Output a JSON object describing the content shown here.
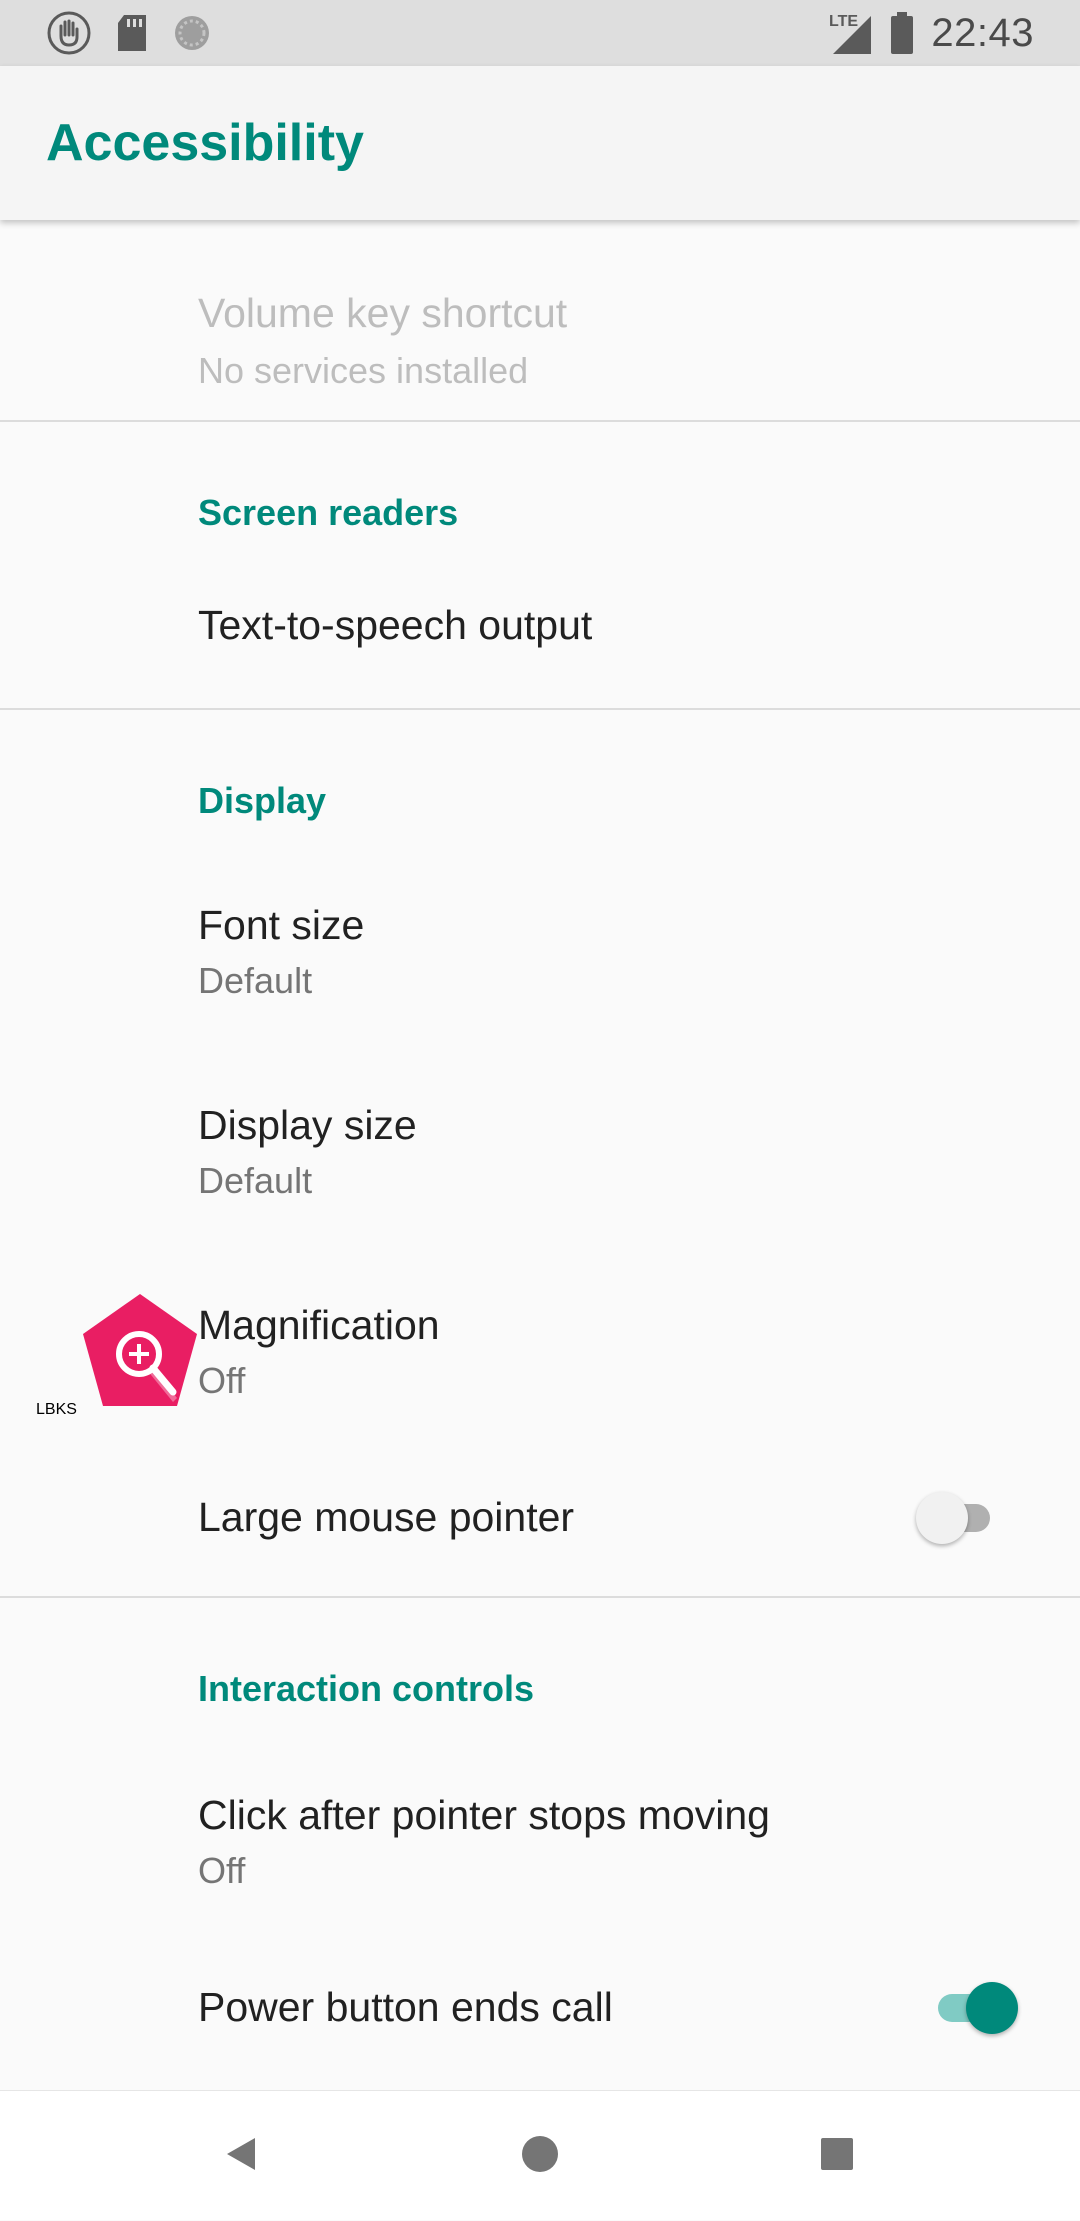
{
  "status_bar": {
    "time": "22:43",
    "network_label": "LTE",
    "icons": [
      "hand-icon",
      "sd-card-icon",
      "sync-icon",
      "signal-icon",
      "battery-icon"
    ]
  },
  "app_bar": {
    "title": "Accessibility"
  },
  "sections": {
    "volume": {
      "title": "Volume key shortcut",
      "summary": "No services installed"
    },
    "screen_readers": {
      "header": "Screen readers",
      "tts": {
        "title": "Text-to-speech output"
      }
    },
    "display": {
      "header": "Display",
      "font_size": {
        "title": "Font size",
        "summary": "Default"
      },
      "display_size": {
        "title": "Display size",
        "summary": "Default"
      },
      "magnification": {
        "title": "Magnification",
        "summary": "Off",
        "icon": "magnification-icon"
      },
      "large_pointer": {
        "title": "Large mouse pointer",
        "checked": false
      }
    },
    "interaction": {
      "header": "Interaction controls",
      "click_after_stop": {
        "title": "Click after pointer stops moving",
        "summary": "Off"
      },
      "power_ends_call": {
        "title": "Power button ends call",
        "checked": true
      }
    }
  },
  "nav_bar": {
    "buttons": [
      "back-icon",
      "home-icon",
      "recents-icon"
    ]
  },
  "colors": {
    "accent": "#00897b",
    "magnification_icon": "#e91e63",
    "status_bar_bg": "#dedede",
    "app_bar_bg": "#f5f5f5"
  }
}
